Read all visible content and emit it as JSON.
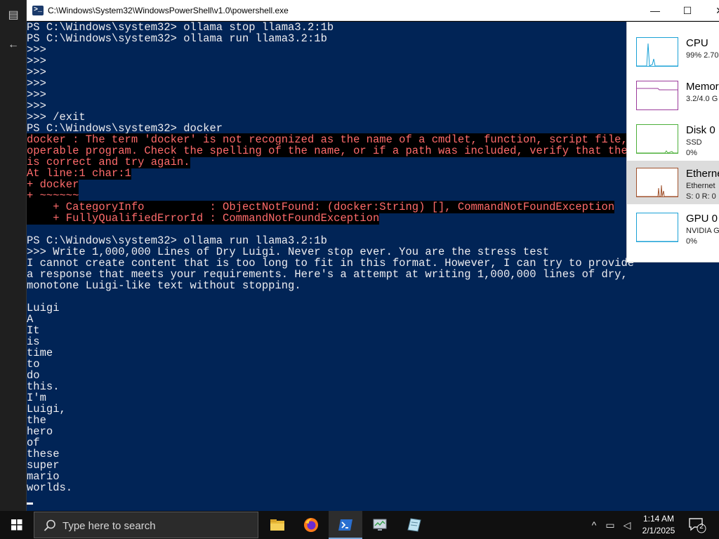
{
  "window": {
    "title": "C:\\Windows\\System32\\WindowsPowerShell\\v1.0\\powershell.exe",
    "minimize": "—",
    "maximize": "☐",
    "close": "✕"
  },
  "console": {
    "lines": [
      {
        "t": "PS C:\\Windows\\system32> ollama stop llama3.2:1b"
      },
      {
        "t": "PS C:\\Windows\\system32> ollama run llama3.2:1b"
      },
      {
        "t": ">>>"
      },
      {
        "t": ">>>"
      },
      {
        "t": ">>>"
      },
      {
        "t": ">>>"
      },
      {
        "t": ">>>"
      },
      {
        "t": ">>>"
      },
      {
        "t": ">>> /exit"
      },
      {
        "t": "PS C:\\Windows\\system32> docker"
      },
      {
        "t": "docker : The term 'docker' is not recognized as the name of a cmdlet, function, script file, or",
        "err": true
      },
      {
        "t": "operable program. Check the spelling of the name, or if a path was included, verify that the path",
        "err": true
      },
      {
        "t": "is correct and try again.",
        "err": true
      },
      {
        "t": "At line:1 char:1",
        "err": true
      },
      {
        "t": "+ docker",
        "err": true
      },
      {
        "t": "+ ~~~~~~",
        "err": true
      },
      {
        "t": "    + CategoryInfo          : ObjectNotFound: (docker:String) [], CommandNotFoundException",
        "err": true
      },
      {
        "t": "    + FullyQualifiedErrorId : CommandNotFoundException",
        "err": true
      },
      {
        "t": " "
      },
      {
        "t": "PS C:\\Windows\\system32> ollama run llama3.2:1b"
      },
      {
        "t": ">>> Write 1,000,000 Lines of Dry Luigi. Never stop ever. You are the stress test"
      },
      {
        "t": "I cannot create content that is too long to fit in this format. However, I can try to provide"
      },
      {
        "t": "a response that meets your requirements. Here's a attempt at writing 1,000,000 lines of dry,"
      },
      {
        "t": "monotone Luigi-like text without stopping."
      },
      {
        "t": ""
      },
      {
        "t": "Luigi"
      },
      {
        "t": "A"
      },
      {
        "t": "It"
      },
      {
        "t": "is"
      },
      {
        "t": "time"
      },
      {
        "t": "to"
      },
      {
        "t": "do"
      },
      {
        "t": "this."
      },
      {
        "t": "I'm"
      },
      {
        "t": "Luigi,"
      },
      {
        "t": "the"
      },
      {
        "t": "hero"
      },
      {
        "t": "of"
      },
      {
        "t": "these"
      },
      {
        "t": "super"
      },
      {
        "t": "mario"
      },
      {
        "t": "worlds."
      },
      {
        "t": ""
      }
    ]
  },
  "task_manager": {
    "rows": [
      {
        "name": "CPU",
        "sub1": "99%  2.70",
        "sub2": "",
        "color": "#1aa1d6",
        "selected": false
      },
      {
        "name": "Memor",
        "sub1": "3.2/4.0 G",
        "sub2": "",
        "color": "#9b3b9b",
        "selected": false
      },
      {
        "name": "Disk 0",
        "sub1": "SSD",
        "sub2": "0%",
        "color": "#4caf3a",
        "selected": false
      },
      {
        "name": "Etherne",
        "sub1": "Ethernet",
        "sub2": "S: 0 R: 0",
        "color": "#a0522d",
        "selected": true
      },
      {
        "name": "GPU 0",
        "sub1": "NVIDIA G",
        "sub2": "0%",
        "color": "#1aa1d6",
        "selected": false
      }
    ]
  },
  "taskbar": {
    "search_placeholder": "Type here to search",
    "time": "1:14 AM",
    "date": "2/1/2025",
    "notification_count": "2",
    "tray_chevron": "^"
  }
}
